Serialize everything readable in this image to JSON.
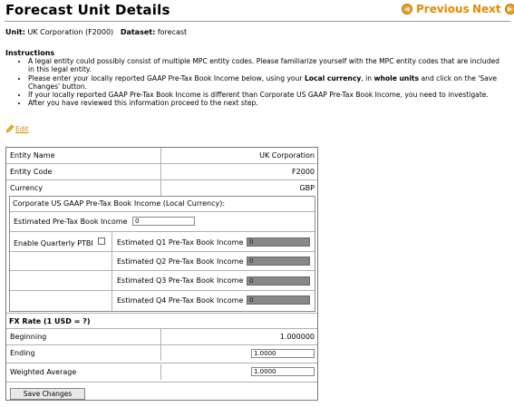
{
  "page": {
    "title": "Forecast Unit Details",
    "previous_label": "Previous",
    "next_label": "Next",
    "unit_label": "Unit:",
    "unit_value": "UK Corporation (F2000)",
    "dataset_label": "Dataset:",
    "dataset_value": "forecast"
  },
  "instructions": {
    "heading": "Instructions",
    "items": [
      "A legal entity could possibly consist of multiple MPC entity codes. Please familiarize yourself with the MPC entity codes that are included in this legal entity.",
      "If your locally reported GAAP Pre-Tax Book Income is different than Corporate US GAAP Pre-Tax Book Income, you need to investigate.",
      "After you have reviewed this information proceed to the next step."
    ],
    "item2": {
      "part1": "Please enter your locally reported GAAP Pre-Tax Book Income below, using your ",
      "bold1": "Local currency",
      "part2": ", in ",
      "bold2": "whole units",
      "part3": " and click on the 'Save Changes' button."
    }
  },
  "edit_label": "Edit",
  "entity": {
    "name_label": "Entity Name",
    "name_value": "UK Corporation",
    "code_label": "Entity Code",
    "code_value": "F2000",
    "currency_label": "Currency",
    "currency_value": "GBP"
  },
  "income": {
    "heading": "Corporate US GAAP Pre-Tax Book Income (Local Currency):",
    "estimated_label": "Estimated Pre-Tax Book Income",
    "estimated_value": "0",
    "quarterly_label": "Enable Quarterly PTBI",
    "q1_label": "Estimated Q1 Pre-Tax Book Income",
    "q1_value": "0",
    "q2_label": "Estimated Q2 Pre-Tax Book Income",
    "q2_value": "0",
    "q3_label": "Estimated Q3 Pre-Tax Book Income",
    "q3_value": "0",
    "q4_label": "Estimated Q4 Pre-Tax Book Income",
    "q4_value": "0"
  },
  "fx": {
    "heading": "FX Rate (1 USD = ?)",
    "beginning_label": "Beginning",
    "beginning_value": "1.000000",
    "ending_label": "Ending",
    "ending_value": "1.0000",
    "weighted_label": "Weighted Average",
    "weighted_value": "1.0000"
  },
  "save_label": "Save Changes",
  "colors": {
    "accent": "#e68a00",
    "disabled_field": "#888888"
  }
}
